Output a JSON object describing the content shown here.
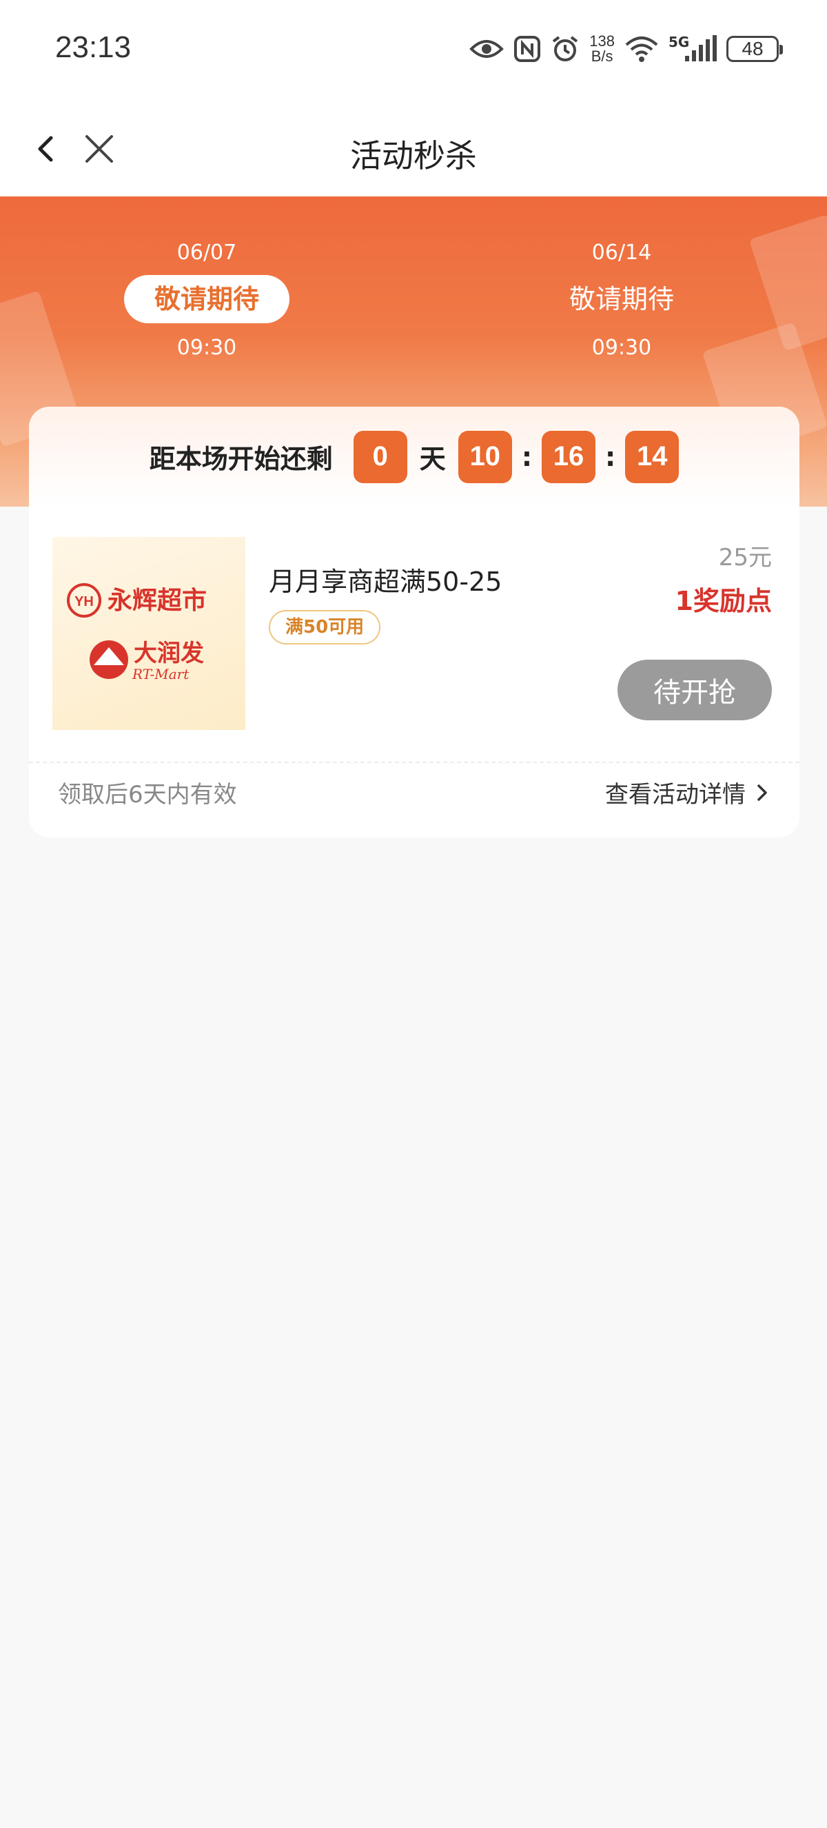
{
  "status_bar": {
    "time": "23:13",
    "net_speed_value": "138",
    "net_speed_unit": "B/s",
    "network": "5G",
    "battery": "48"
  },
  "nav": {
    "title": "活动秒杀",
    "back_icon": "chevron-left-icon",
    "close_icon": "close-icon"
  },
  "sessions": [
    {
      "date": "06/07",
      "label": "敬请期待",
      "time": "09:30",
      "active": true
    },
    {
      "date": "06/14",
      "label": "敬请期待",
      "time": "09:30",
      "active": false
    }
  ],
  "countdown": {
    "label": "距本场开始还剩",
    "days": "0",
    "day_unit": "天",
    "hours": "10",
    "minutes": "16",
    "seconds": "14",
    "separator": ":"
  },
  "product": {
    "name": "月月享商超满50-25",
    "tag": "满50可用",
    "price": "25元",
    "points": "1奖励点",
    "button_label": "待开抢",
    "logo_brand_1": "永辉超市",
    "logo_brand_1_mark": "YH",
    "logo_brand_2": "大润发",
    "logo_brand_2_sub": "RT-Mart"
  },
  "footer": {
    "validity": "领取后6天内有效",
    "detail_link": "查看活动详情"
  },
  "colors": {
    "accent_orange": "#ea6a2f",
    "points_red": "#d8342c",
    "tag_orange": "#d8842a",
    "button_gray": "#9b9b9b"
  }
}
